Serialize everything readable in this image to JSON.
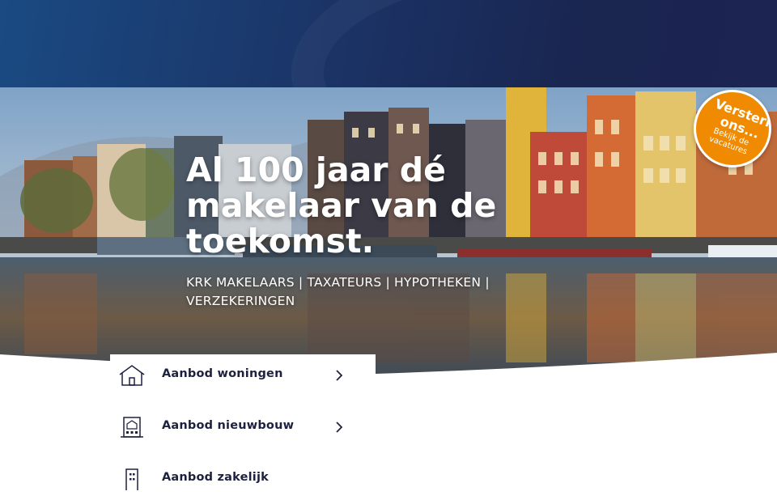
{
  "hero": {
    "title": "Al 100 jaar dé makelaar van de toekomst.",
    "subtitle": "KRK MAKELAARS | TAXATEURS | HYPOTHEKEN | VERZEKERINGEN"
  },
  "badge": {
    "title": "Versterk ons...",
    "text": "Bekijk de vacatures"
  },
  "menu": {
    "items": [
      {
        "label": "Aanbod woningen",
        "icon": "house-icon"
      },
      {
        "label": "Aanbod nieuwbouw",
        "icon": "building-icon"
      },
      {
        "label": "Aanbod zakelijk",
        "icon": "office-icon"
      }
    ]
  },
  "colors": {
    "header": "#1b3568",
    "badge": "#f08a00",
    "menu_text": "#1d2140"
  }
}
